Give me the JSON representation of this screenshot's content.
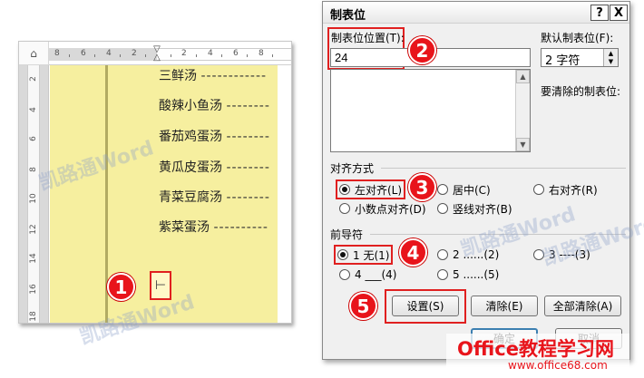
{
  "document": {
    "ruler_corner_icon": "tab-type-icon",
    "ruler_labels": [
      "8",
      "6",
      "4",
      "2",
      "2",
      "4",
      "6",
      "8"
    ],
    "vruler_labels": [
      "2",
      "4",
      "6",
      "8",
      "10",
      "12",
      "14",
      "16",
      "18"
    ],
    "menu": [
      {
        "name": "三鲜汤",
        "dots": "------------"
      },
      {
        "name": "酸辣小鱼汤",
        "dots": "--------"
      },
      {
        "name": "番茄鸡蛋汤",
        "dots": "--------"
      },
      {
        "name": "黄瓜皮蛋汤",
        "dots": "--------"
      },
      {
        "name": "青菜豆腐汤",
        "dots": "--------"
      },
      {
        "name": "紫菜蛋汤",
        "dots": "----------"
      }
    ],
    "cursor_glyph": "⊢",
    "watermark": "凯路通Word"
  },
  "steps": [
    "1",
    "2",
    "3",
    "4",
    "5"
  ],
  "dialog": {
    "title": "制表位",
    "help_button": "?",
    "close_button": "X",
    "tab_position_label": "制表位位置(T):",
    "tab_position_value": "24",
    "default_tab_label": "默认制表位(F):",
    "default_tab_value": "2 字符",
    "clear_label": "要清除的制表位:",
    "alignment_title": "对齐方式",
    "alignment": [
      {
        "label": "左对齐(L)",
        "selected": true
      },
      {
        "label": "居中(C)",
        "selected": false
      },
      {
        "label": "右对齐(R)",
        "selected": false
      },
      {
        "label": "小数点对齐(D)",
        "selected": false
      },
      {
        "label": "竖线对齐(B)",
        "selected": false
      }
    ],
    "leader_title": "前导符",
    "leaders": [
      {
        "label": "1 无(1)",
        "selected": true
      },
      {
        "label": "2 ......(2)",
        "selected": false
      },
      {
        "label": "3 ----(3)",
        "selected": false
      },
      {
        "label": "4 ___(4)",
        "selected": false
      },
      {
        "label": "5 ......(5)",
        "selected": false
      }
    ],
    "set_button": "设置(S)",
    "clear_button": "清除(E)",
    "clear_all_button": "全部清除(A)",
    "ok_button": "确定",
    "cancel_button": "取消",
    "watermark": "凯路通Word"
  },
  "brand": {
    "name": "Office教程学习网",
    "url": "www.office68.com"
  }
}
